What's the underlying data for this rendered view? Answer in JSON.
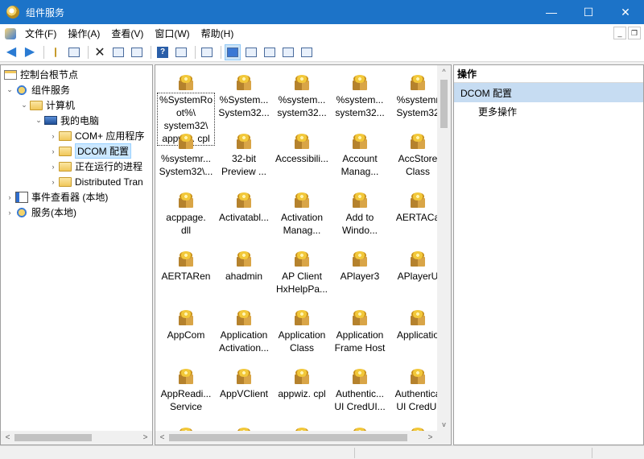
{
  "window": {
    "title": "组件服务",
    "minimize": "—",
    "maximize": "☐",
    "close": "✕"
  },
  "menu": {
    "items": [
      "文件(F)",
      "操作(A)",
      "查看(V)",
      "窗口(W)",
      "帮助(H)"
    ],
    "child_minimize": "_",
    "child_restore": "❐"
  },
  "tree": {
    "nodes": [
      {
        "label": "控制台根节点",
        "toggle": "",
        "icon": "console-icon"
      },
      {
        "label": "组件服务",
        "toggle": "⌄",
        "icon": "component-services-icon"
      },
      {
        "label": "计算机",
        "toggle": "⌄",
        "icon": "folder-icon"
      },
      {
        "label": "我的电脑",
        "toggle": "⌄",
        "icon": "computer-icon"
      },
      {
        "label": "COM+ 应用程序",
        "toggle": "›",
        "icon": "folder-icon"
      },
      {
        "label": "DCOM 配置",
        "toggle": "›",
        "icon": "folder-icon",
        "selected": true
      },
      {
        "label": "正在运行的进程",
        "toggle": "›",
        "icon": "folder-icon"
      },
      {
        "label": "Distributed Tran",
        "toggle": "›",
        "icon": "folder-icon"
      },
      {
        "label": "事件查看器 (本地)",
        "toggle": "›",
        "icon": "event-viewer-icon"
      },
      {
        "label": "服务(本地)",
        "toggle": "›",
        "icon": "services-icon"
      }
    ],
    "scroll_left": "<",
    "scroll_right": ">"
  },
  "grid": {
    "items": [
      {
        "label": "%SystemRo\not%\\\nsystem32\\\nappwiz. cpl",
        "focused": true
      },
      {
        "label": "%System...\nSystem32..."
      },
      {
        "label": "%system...\nsystem32..."
      },
      {
        "label": "%system...\nsystem32..."
      },
      {
        "label": "%systemr\nSystem32"
      },
      {
        "label": "%systemr...\nSystem32\\..."
      },
      {
        "label": "32-bit\nPreview ..."
      },
      {
        "label": "Accessibili..."
      },
      {
        "label": "Account\nManag..."
      },
      {
        "label": "AccStore\nClass"
      },
      {
        "label": "acppage.\ndll"
      },
      {
        "label": "Activatabl..."
      },
      {
        "label": "Activation\nManag..."
      },
      {
        "label": "Add to\nWindo..."
      },
      {
        "label": "AERTACa"
      },
      {
        "label": "AERTARen"
      },
      {
        "label": "ahadmin"
      },
      {
        "label": "AP Client\nHxHelpPa..."
      },
      {
        "label": "APlayer3"
      },
      {
        "label": "APlayerU"
      },
      {
        "label": "AppCom"
      },
      {
        "label": "Application\nActivation..."
      },
      {
        "label": "Application\nClass"
      },
      {
        "label": "Application\nFrame Host"
      },
      {
        "label": "Applicatio"
      },
      {
        "label": "AppReadi...\nService"
      },
      {
        "label": "AppVClient"
      },
      {
        "label": "appwiz. cpl"
      },
      {
        "label": "Authentic...\nUI CredUI..."
      },
      {
        "label": "Authentica\nUI CredUI"
      },
      {
        "label": ""
      },
      {
        "label": ""
      },
      {
        "label": ""
      },
      {
        "label": ""
      },
      {
        "label": ""
      }
    ],
    "scroll_up": "^",
    "scroll_down": "v",
    "scroll_left": "<",
    "scroll_right": ">"
  },
  "actions": {
    "header": "操作",
    "section": "DCOM 配置",
    "more": "更多操作"
  }
}
